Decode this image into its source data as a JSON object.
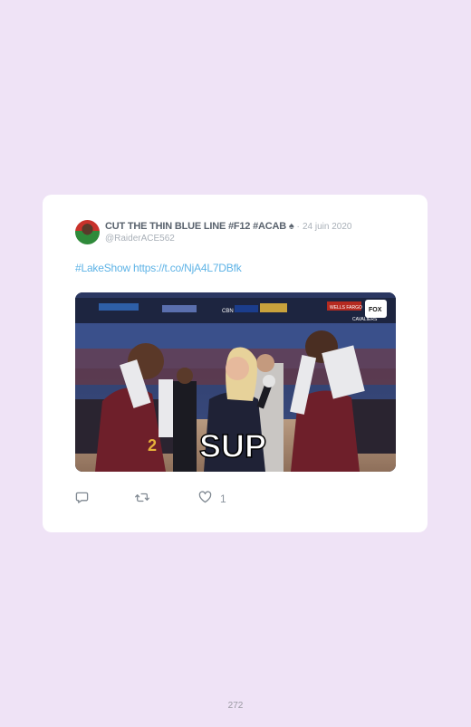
{
  "tweet": {
    "display_name": "CUT THE THIN BLUE LINE #F12 #ACAB ♠",
    "separator": "·",
    "date": "24 juin 2020",
    "handle": "@RaiderACE562",
    "text": "#LakeShow https://t.co/NjA4L7DBfk",
    "media": {
      "caption": "SUP",
      "scoreboard_labels": [
        "CBN",
        "WELLS FARGO",
        "FOX",
        "CAVALIERS"
      ]
    },
    "actions": {
      "reply_icon": "reply-icon",
      "retweet_icon": "retweet-icon",
      "like_icon": "heart-icon",
      "like_count": "1"
    }
  },
  "page": {
    "number": "272"
  },
  "colors": {
    "background": "#efe3f6",
    "link": "#5eb3e6",
    "card": "#ffffff"
  }
}
